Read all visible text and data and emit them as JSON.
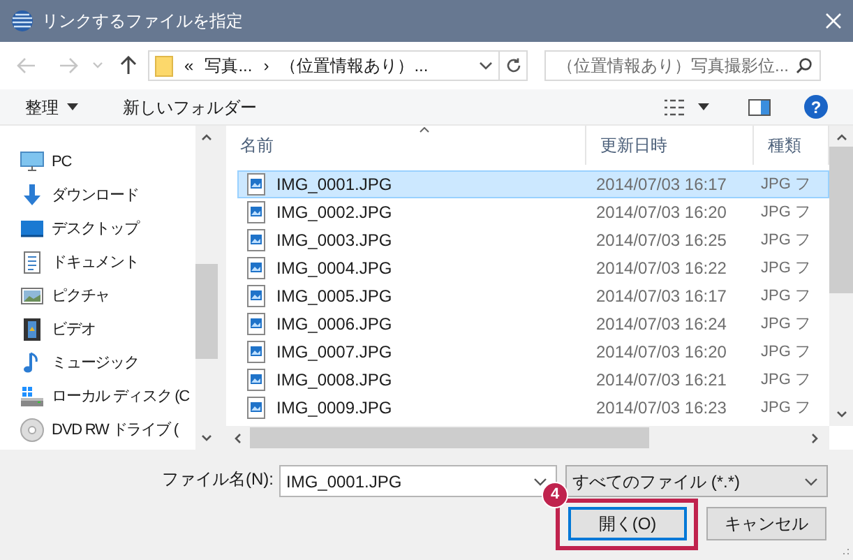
{
  "window": {
    "title": "リンクするファイルを指定"
  },
  "address": {
    "path": [
      "«",
      "写真...",
      "›",
      "（位置情報あり）..."
    ]
  },
  "search": {
    "placeholder": "（位置情報あり）写真撮影位..."
  },
  "toolbar": {
    "organize": "整理",
    "new_folder": "新しいフォルダー",
    "help": "?"
  },
  "navigation": [
    {
      "kind": "pc",
      "label": "PC"
    },
    {
      "kind": "download",
      "label": "ダウンロード"
    },
    {
      "kind": "desktop",
      "label": "デスクトップ"
    },
    {
      "kind": "document",
      "label": "ドキュメント"
    },
    {
      "kind": "picture",
      "label": "ピクチャ"
    },
    {
      "kind": "video",
      "label": "ビデオ"
    },
    {
      "kind": "music",
      "label": "ミュージック"
    },
    {
      "kind": "drive",
      "label": "ローカル ディスク (C"
    },
    {
      "kind": "dvd",
      "label": "DVD RW ドライブ ("
    }
  ],
  "table": {
    "columns": [
      "名前",
      "更新日時",
      "種類"
    ],
    "rows": [
      {
        "name": "IMG_0001.JPG",
        "modified": "2014/07/03 16:17",
        "type": "JPG フ",
        "selected": true
      },
      {
        "name": "IMG_0002.JPG",
        "modified": "2014/07/03 16:20",
        "type": "JPG フ",
        "selected": false
      },
      {
        "name": "IMG_0003.JPG",
        "modified": "2014/07/03 16:25",
        "type": "JPG フ",
        "selected": false
      },
      {
        "name": "IMG_0004.JPG",
        "modified": "2014/07/03 16:22",
        "type": "JPG フ",
        "selected": false
      },
      {
        "name": "IMG_0005.JPG",
        "modified": "2014/07/03 16:17",
        "type": "JPG フ",
        "selected": false
      },
      {
        "name": "IMG_0006.JPG",
        "modified": "2014/07/03 16:24",
        "type": "JPG フ",
        "selected": false
      },
      {
        "name": "IMG_0007.JPG",
        "modified": "2014/07/03 16:20",
        "type": "JPG フ",
        "selected": false
      },
      {
        "name": "IMG_0008.JPG",
        "modified": "2014/07/03 16:21",
        "type": "JPG フ",
        "selected": false
      },
      {
        "name": "IMG_0009.JPG",
        "modified": "2014/07/03 16:23",
        "type": "JPG フ",
        "selected": false
      }
    ]
  },
  "file_name": {
    "label": "ファイル名(N):",
    "value": "IMG_0001.JPG"
  },
  "file_type": {
    "value": "すべてのファイル (*.*)"
  },
  "buttons": [
    {
      "label": "開く(O)",
      "default": true
    },
    {
      "label": "キャンセル",
      "default": false
    }
  ],
  "annotation": {
    "number": "4"
  }
}
